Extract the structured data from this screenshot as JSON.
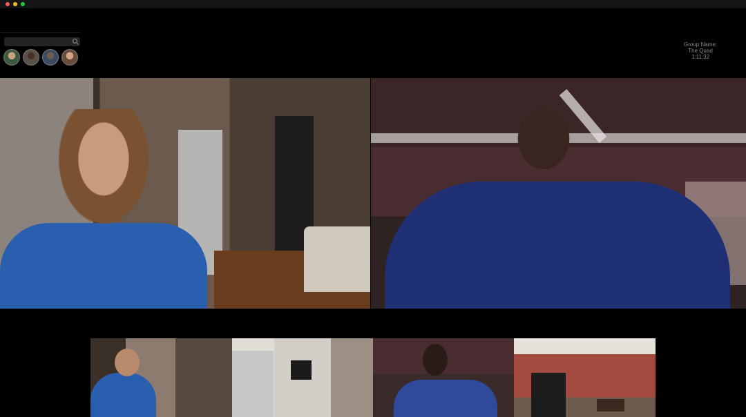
{
  "window": {
    "controls": [
      "close",
      "minimize",
      "maximize"
    ]
  },
  "search": {
    "placeholder": "",
    "icon": "search-icon"
  },
  "participants_avatars": [
    "avatar-1",
    "avatar-2",
    "avatar-3",
    "avatar-4"
  ],
  "group": {
    "name_label": "Group  Name:",
    "name": "The Quad",
    "duration": "1:11:32"
  },
  "colors": {
    "background": "#000000",
    "titlebar": "#151515",
    "info_text": "#8b8b8b"
  }
}
